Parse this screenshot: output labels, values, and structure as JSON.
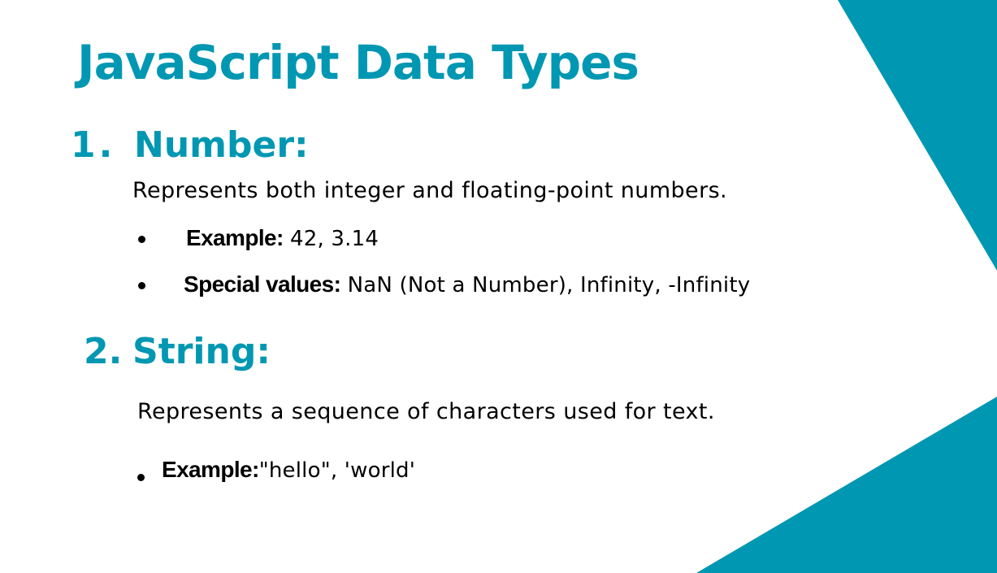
{
  "colors": {
    "accent": "#0097B2",
    "background": "#FFFFFF",
    "text": "#000000"
  },
  "title": "JavaScript Data Types",
  "sections": [
    {
      "number": "1.",
      "heading": "Number:",
      "description": "Represents both integer and floating-point numbers.",
      "bullets": [
        {
          "label": "Example:",
          "value": "42, 3.14"
        },
        {
          "label": "Special values:",
          "value": "NaN (Not a Number), Infinity, -Infinity"
        }
      ]
    },
    {
      "number": "2.",
      "heading": "String:",
      "description": "Represents a sequence of characters used for text.",
      "bullets": [
        {
          "label": "Example:",
          "value": "\"hello\", 'world'"
        }
      ]
    }
  ]
}
